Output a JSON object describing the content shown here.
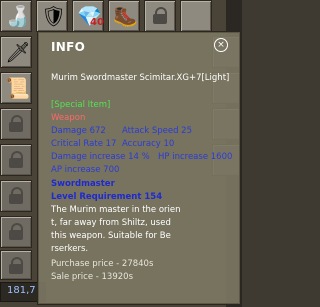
{
  "tooltip": {
    "title": "INFO",
    "close_glyph": "×",
    "item_name": "Murim Swordmaster Scimitar.XG+7[Light]",
    "category": "[Special Item]",
    "type": "Weapon",
    "damage": "Damage 672",
    "attack_speed": "Attack Speed 25",
    "critical_rate": "Critical Rate 17",
    "accuracy": "Accuracy 10",
    "damage_increase": "Damage increase 14 %",
    "hp_increase": "HP increase 1600",
    "ap_increase": "AP increase 700",
    "class": "Swordmaster",
    "level_req": "Level Requirement 154",
    "description": [
      "The Murim master in the orien",
      "t, far away from Shiltz, used",
      " this weapon. Suitable for Be",
      "rserkers."
    ],
    "purchase_price": "Purchase price - 27840s",
    "sale_price": "Sale price - 13920s"
  },
  "inventory": {
    "gold": "181,7",
    "badge_count": "40"
  },
  "colors": {
    "green": "#55e355",
    "red": "#ff6969",
    "blue": "#2a3bd9"
  }
}
